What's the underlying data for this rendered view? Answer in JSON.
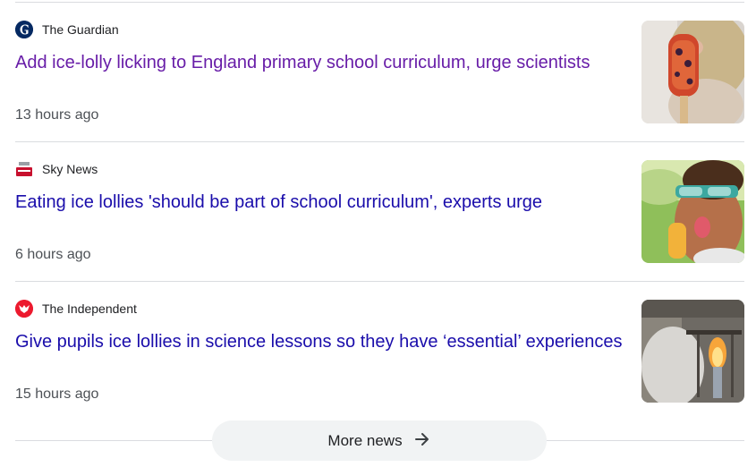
{
  "articles": [
    {
      "source": "The Guardian",
      "source_icon": "guardian-logo-icon",
      "headline": "Add ice-lolly licking to England primary school curriculum, urge scientists",
      "time": "13 hours ago",
      "visited": true,
      "thumbnail": "child-with-ice-lolly-photo"
    },
    {
      "source": "Sky News",
      "source_icon": "sky-news-logo-icon",
      "headline": "Eating ice lollies 'should be part of school curriculum', experts urge",
      "time": "6 hours ago",
      "visited": false,
      "thumbnail": "child-in-sunglasses-licking-ice-lolly-photo"
    },
    {
      "source": "The Independent",
      "source_icon": "independent-eagle-logo-icon",
      "headline": "Give pupils ice lollies in science lessons so they have ‘essential’ experiences",
      "time": "15 hours ago",
      "visited": false,
      "thumbnail": "science-lesson-flame-photo"
    }
  ],
  "more_news": {
    "label": "More news",
    "icon": "arrow-right-icon"
  },
  "colors": {
    "visited_link": "#681da8",
    "link": "#1a0dab",
    "meta_text": "#4d5156",
    "divider": "#dadce0",
    "button_bg": "#f1f3f4"
  }
}
